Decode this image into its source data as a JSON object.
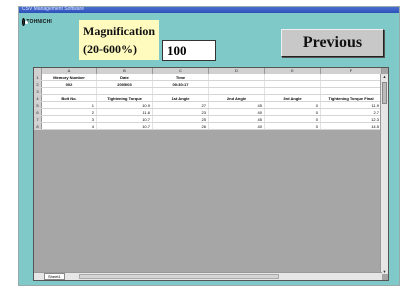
{
  "window": {
    "title": "CSV Management Software"
  },
  "logo": {
    "text": "TOHNICHI"
  },
  "magnification": {
    "label_line1": "Magnification",
    "label_line2": "(20-600%)",
    "value": "100"
  },
  "previous_button": {
    "label": "Previous"
  },
  "sheet": {
    "columns": [
      "A",
      "B",
      "C",
      "D",
      "E",
      "F"
    ],
    "rows": [
      {
        "n": "1",
        "cells": [
          "Memory Number",
          "Date",
          "Time",
          "",
          "",
          ""
        ],
        "header": true
      },
      {
        "n": "2",
        "cells": [
          "002",
          "2005/03",
          "00:30:17",
          "",
          "",
          ""
        ],
        "header": false
      },
      {
        "n": "3",
        "cells": [
          "",
          "",
          "",
          "",
          "",
          ""
        ],
        "header": false
      },
      {
        "n": "4",
        "cells": [
          "Bolt No.",
          "Tightening Torque",
          "1st Angle",
          "2nd Angle",
          "3rd Angle",
          "Tightening Torque Final"
        ],
        "header": true
      },
      {
        "n": "5",
        "cells": [
          "1",
          "10.9",
          "27",
          "45",
          "0",
          "11.9"
        ],
        "header": false
      },
      {
        "n": "6",
        "cells": [
          "2",
          "11.6",
          "23",
          "40",
          "0",
          "2.7"
        ],
        "header": false
      },
      {
        "n": "7",
        "cells": [
          "3",
          "10.7",
          "25",
          "45",
          "0",
          "12.3"
        ],
        "header": false
      },
      {
        "n": "8",
        "cells": [
          "4",
          "10.7",
          "26",
          "40",
          "0",
          "14.5"
        ],
        "header": false
      }
    ],
    "sheet_tab": "Sheet1"
  }
}
